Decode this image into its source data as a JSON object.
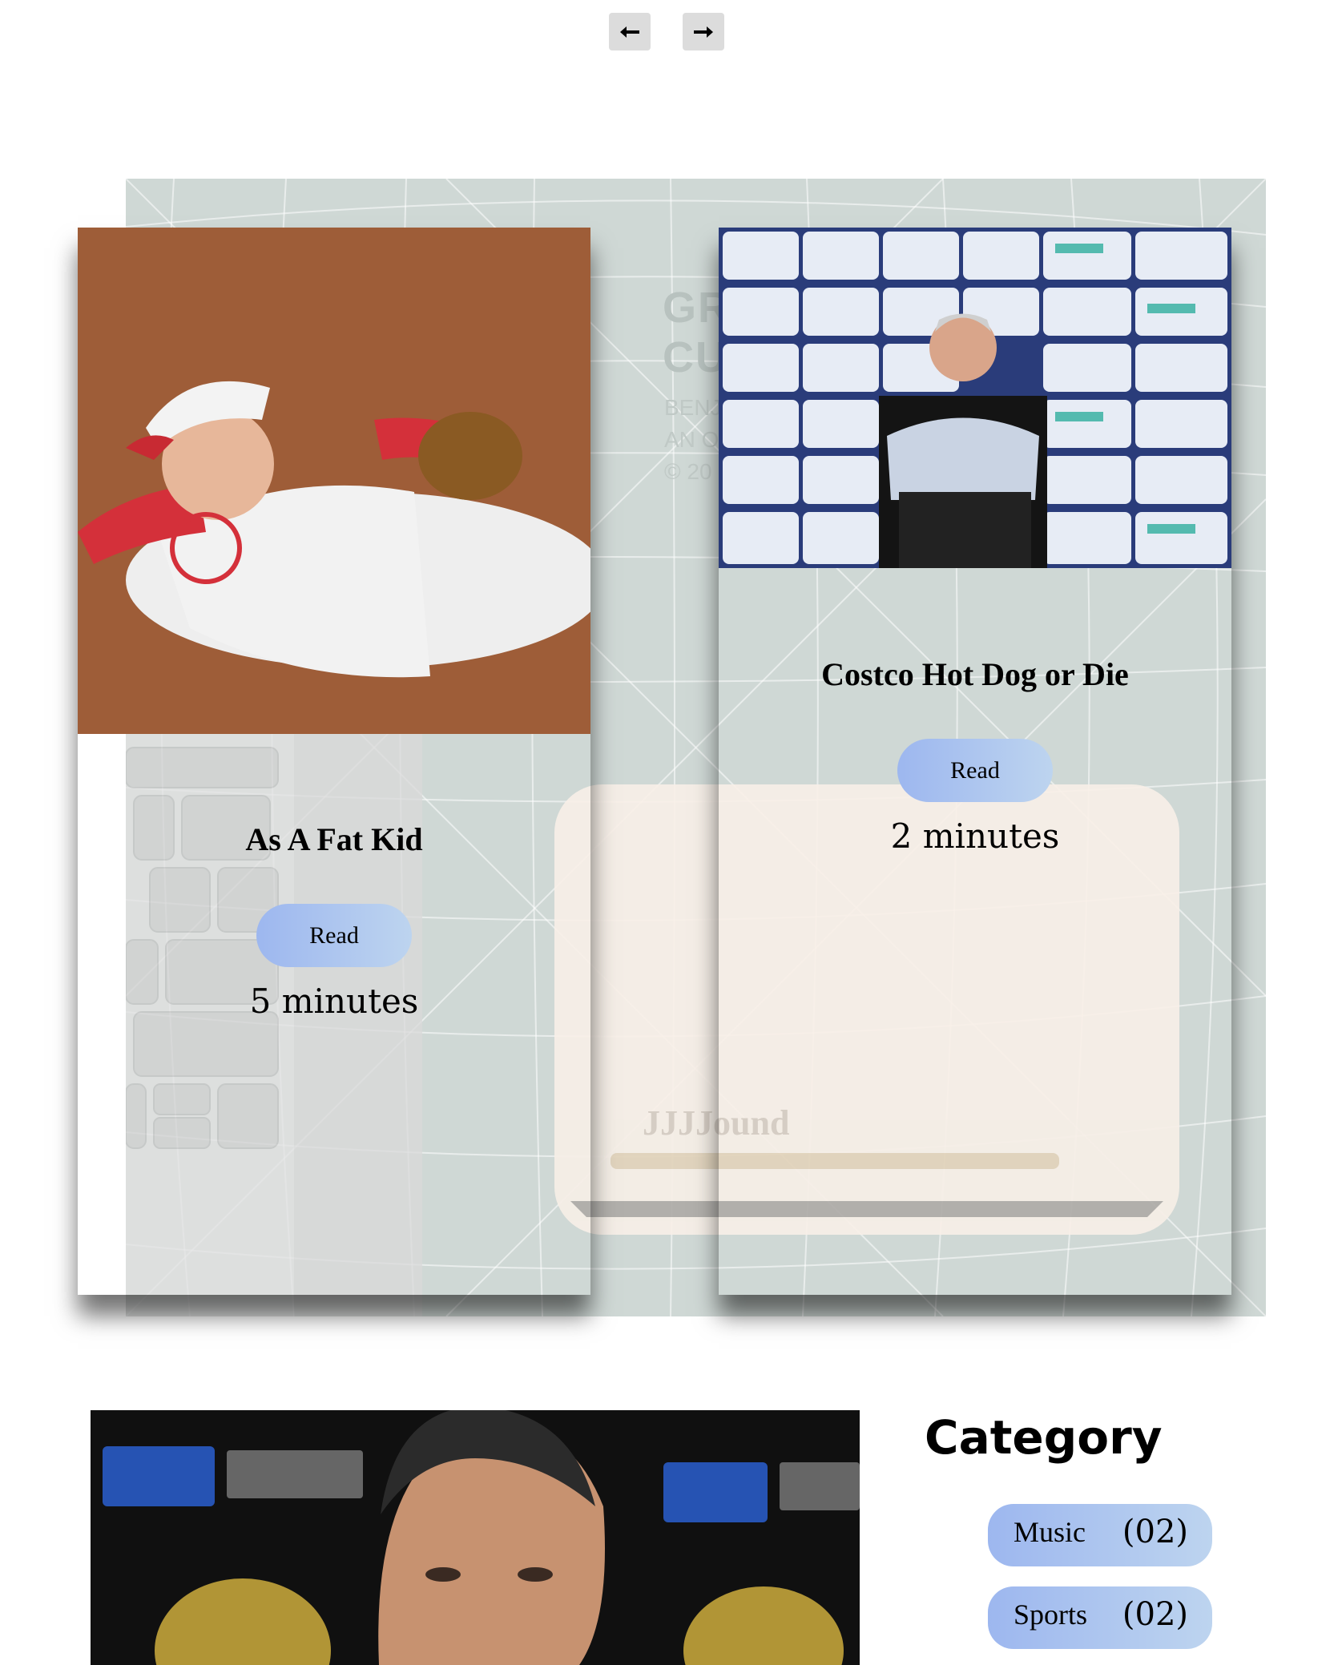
{
  "nav": {
    "prev_icon": "arrow-left-icon",
    "next_icon": "arrow-right-icon"
  },
  "backdrop": {
    "ghost_heading": "GR\nCU",
    "ghost_lines": "BENJ\nAN O\n© 20",
    "ghost_brand": "JJJJound"
  },
  "posts": [
    {
      "title": "As A Fat Kid",
      "read_label": "Read",
      "read_time": "5 minutes"
    },
    {
      "title": "Costco Hot Dog or Die",
      "read_label": "Read",
      "read_time": "2 minutes"
    }
  ],
  "category": {
    "heading": "Category",
    "items": [
      {
        "name": "Music",
        "count": "(02)"
      },
      {
        "name": "Sports",
        "count": "(02)"
      }
    ]
  },
  "colors": {
    "pill_start": "#9db7ef",
    "pill_end": "#bdd4ef",
    "arrow_button": "#dcdcdc",
    "backdrop": "#cfd8d5"
  }
}
